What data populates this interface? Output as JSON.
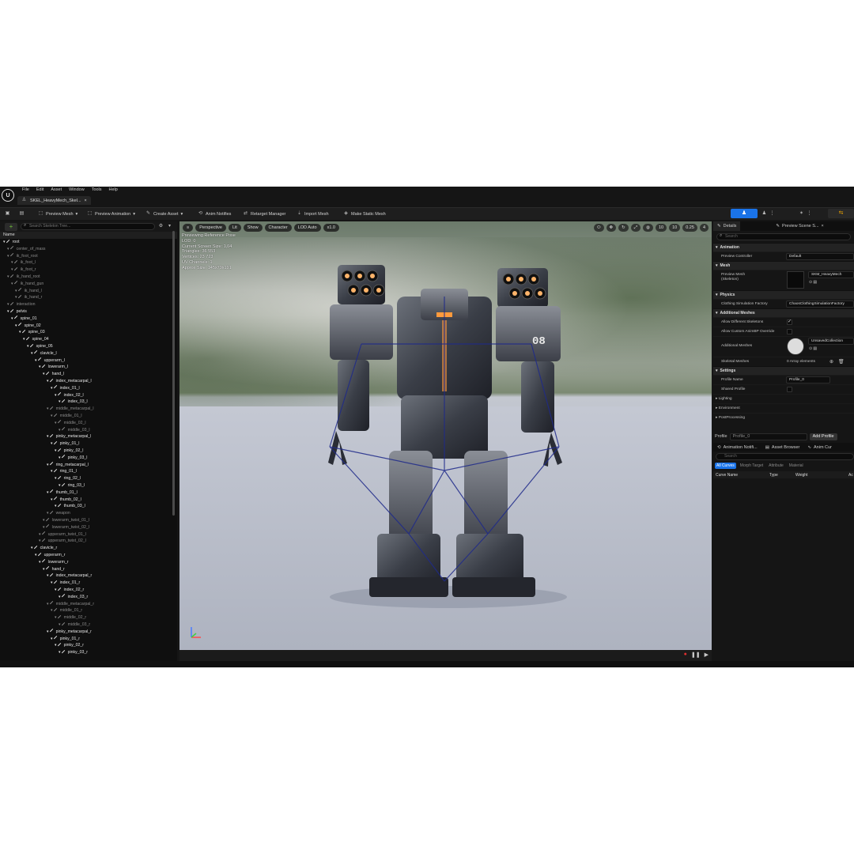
{
  "menubar": {
    "logo": "U",
    "items": [
      "File",
      "Edit",
      "Asset",
      "Window",
      "Tools",
      "Help"
    ]
  },
  "tabs": [
    {
      "label": "SKEL_HeavyMech_Skel...",
      "close": "×"
    }
  ],
  "toolbar": {
    "preview_mesh": "Preview Mesh",
    "preview_animation": "Preview Animation",
    "create_asset": "Create Asset",
    "anim_notifies": "Anim Notifies",
    "retarget_manager": "Retarget Manager",
    "import_mesh": "Import Mesh",
    "make_static_mesh": "Make Static Mesh"
  },
  "skeleton_tree": {
    "search_placeholder": "Search Skeleton Tree...",
    "column": "Name",
    "bones": [
      {
        "name": "root",
        "level": 0,
        "hi": true
      },
      {
        "name": "center_of_mass",
        "level": 1,
        "hi": false
      },
      {
        "name": "ik_foot_root",
        "level": 1,
        "hi": false
      },
      {
        "name": "ik_foot_l",
        "level": 2,
        "hi": false
      },
      {
        "name": "ik_foot_r",
        "level": 2,
        "hi": false
      },
      {
        "name": "ik_hand_root",
        "level": 1,
        "hi": false
      },
      {
        "name": "ik_hand_gun",
        "level": 2,
        "hi": false
      },
      {
        "name": "ik_hand_l",
        "level": 3,
        "hi": false
      },
      {
        "name": "ik_hand_r",
        "level": 3,
        "hi": false
      },
      {
        "name": "interaction",
        "level": 1,
        "hi": false
      },
      {
        "name": "pelvis",
        "level": 1,
        "hi": true
      },
      {
        "name": "spine_01",
        "level": 2,
        "hi": true
      },
      {
        "name": "spine_02",
        "level": 3,
        "hi": true
      },
      {
        "name": "spine_03",
        "level": 4,
        "hi": true
      },
      {
        "name": "spine_04",
        "level": 5,
        "hi": true
      },
      {
        "name": "spine_05",
        "level": 6,
        "hi": true
      },
      {
        "name": "clavicle_l",
        "level": 7,
        "hi": true
      },
      {
        "name": "upperarm_l",
        "level": 8,
        "hi": true
      },
      {
        "name": "lowerarm_l",
        "level": 9,
        "hi": true
      },
      {
        "name": "hand_l",
        "level": 10,
        "hi": true
      },
      {
        "name": "index_metacarpal_l",
        "level": 11,
        "hi": true
      },
      {
        "name": "index_01_l",
        "level": 12,
        "hi": true
      },
      {
        "name": "index_02_l",
        "level": 13,
        "hi": true
      },
      {
        "name": "index_03_l",
        "level": 14,
        "hi": true
      },
      {
        "name": "middle_metacarpal_l",
        "level": 11,
        "hi": false
      },
      {
        "name": "middle_01_l",
        "level": 12,
        "hi": false
      },
      {
        "name": "middle_02_l",
        "level": 13,
        "hi": false
      },
      {
        "name": "middle_03_l",
        "level": 14,
        "hi": false
      },
      {
        "name": "pinky_metacarpal_l",
        "level": 11,
        "hi": true
      },
      {
        "name": "pinky_01_l",
        "level": 12,
        "hi": true
      },
      {
        "name": "pinky_02_l",
        "level": 13,
        "hi": true
      },
      {
        "name": "pinky_03_l",
        "level": 14,
        "hi": true
      },
      {
        "name": "ring_metacarpal_l",
        "level": 11,
        "hi": true
      },
      {
        "name": "ring_01_l",
        "level": 12,
        "hi": true
      },
      {
        "name": "ring_02_l",
        "level": 13,
        "hi": true
      },
      {
        "name": "ring_03_l",
        "level": 14,
        "hi": true
      },
      {
        "name": "thumb_01_l",
        "level": 11,
        "hi": true
      },
      {
        "name": "thumb_02_l",
        "level": 12,
        "hi": true
      },
      {
        "name": "thumb_03_l",
        "level": 13,
        "hi": true
      },
      {
        "name": "weapon",
        "level": 11,
        "hi": false
      },
      {
        "name": "lowerarm_twist_01_l",
        "level": 10,
        "hi": false
      },
      {
        "name": "lowerarm_twist_02_l",
        "level": 10,
        "hi": false
      },
      {
        "name": "upperarm_twist_01_l",
        "level": 9,
        "hi": false
      },
      {
        "name": "upperarm_twist_02_l",
        "level": 9,
        "hi": false
      },
      {
        "name": "clavicle_r",
        "level": 7,
        "hi": true
      },
      {
        "name": "upperarm_r",
        "level": 8,
        "hi": true
      },
      {
        "name": "lowerarm_r",
        "level": 9,
        "hi": true
      },
      {
        "name": "hand_r",
        "level": 10,
        "hi": true
      },
      {
        "name": "index_metacarpal_r",
        "level": 11,
        "hi": true
      },
      {
        "name": "index_01_r",
        "level": 12,
        "hi": true
      },
      {
        "name": "index_02_r",
        "level": 13,
        "hi": true
      },
      {
        "name": "index_03_r",
        "level": 14,
        "hi": true
      },
      {
        "name": "middle_metacarpal_r",
        "level": 11,
        "hi": false
      },
      {
        "name": "middle_01_r",
        "level": 12,
        "hi": false
      },
      {
        "name": "middle_02_r",
        "level": 13,
        "hi": false
      },
      {
        "name": "middle_03_r",
        "level": 14,
        "hi": false
      },
      {
        "name": "pinky_metacarpal_r",
        "level": 11,
        "hi": true
      },
      {
        "name": "pinky_01_r",
        "level": 12,
        "hi": true
      },
      {
        "name": "pinky_02_r",
        "level": 13,
        "hi": true
      },
      {
        "name": "pinky_03_r",
        "level": 14,
        "hi": true
      }
    ]
  },
  "viewport": {
    "perspective": "Perspective",
    "lit": "Lit",
    "show": "Show",
    "character": "Character",
    "lod": "LOD Auto",
    "speed": "x1.0",
    "fov_value": "10",
    "angle_value": "10",
    "scale_value": "0.25",
    "camera_speed": "4",
    "stats": [
      "Previewing Reference Pose",
      "LOD: 0",
      "Current Screen Size: 1,04",
      "Triangles: 36 553",
      "Vertices: 23 723",
      "UV Channels: 1",
      "Approx Size: 145x79x191"
    ],
    "mech_number": "08"
  },
  "details": {
    "tab_details": "Details",
    "tab_preview": "Preview Scene S...",
    "search_placeholder": "Search",
    "sections": {
      "animation": "Animation",
      "mesh": "Mesh",
      "physics": "Physics",
      "additional_meshes": "Additional Meshes",
      "settings": "Settings",
      "lighting": "Lighting",
      "environment": "Environment",
      "postprocessing": "PostProcessing"
    },
    "preview_controller_label": "Preview Controller",
    "preview_controller_value": "Default",
    "preview_mesh_label": "Preview Mesh",
    "preview_mesh_sub": "(Skeleton)",
    "preview_mesh_value": "SKM_HeavyMech",
    "clothing_label": "Clothing Simulation Factory",
    "clothing_value": "ChaosClothingSimulationFactory",
    "allow_diff_label": "Allow Different Skeletons",
    "allow_custom_label": "Allow Custom AnimBP Override",
    "additional_meshes_label": "Additional Meshes",
    "additional_meshes_value": "UnsavedCollection",
    "skeletal_meshes_label": "Skeletal Meshes",
    "skeletal_meshes_value": "0 Array elements",
    "profile_name_label": "Profile Name",
    "profile_name_value": "Profile_0",
    "shared_profile_label": "Shared Profile"
  },
  "profile": {
    "label": "Profile",
    "value": "Profile_0",
    "add": "Add Profile"
  },
  "anim_curves": {
    "tab_notifies": "Animation Notifi...",
    "tab_browser": "Asset Browser",
    "tab_curves": "Anim Cur",
    "search_placeholder": "Search",
    "filters": [
      "All Curves",
      "Morph Target",
      "Attribute",
      "Material"
    ],
    "columns": [
      "Curve Name",
      "Type",
      "Weight",
      "Ac"
    ]
  },
  "colors": {
    "accent": "#1a73e8",
    "panel": "#151515",
    "orange": "#f0a500",
    "green": "#6ebd3a"
  }
}
